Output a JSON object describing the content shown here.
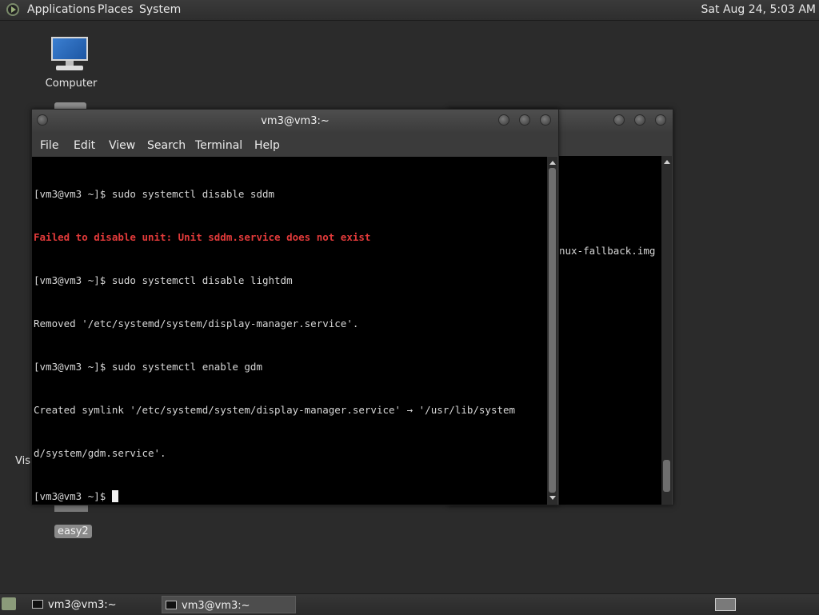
{
  "top_panel": {
    "menus": [
      "Applications",
      "Places",
      "System"
    ],
    "clock": "Sat Aug 24,  5:03 AM"
  },
  "desktop": {
    "icons": [
      {
        "label": "Computer"
      },
      {
        "label": "easy2"
      }
    ],
    "partial_label": "Visu"
  },
  "back_window": {
    "visible_text": "nux-fallback.img"
  },
  "terminal": {
    "title": "vm3@vm3:~",
    "menu": [
      "File",
      "Edit",
      "View",
      "Search",
      "Terminal",
      "Help"
    ],
    "lines": [
      {
        "text": "[vm3@vm3 ~]$ sudo systemctl disable sddm",
        "style": "normal"
      },
      {
        "text": "Failed to disable unit: Unit sddm.service does not exist",
        "style": "error"
      },
      {
        "text": "[vm3@vm3 ~]$ sudo systemctl disable lightdm",
        "style": "normal"
      },
      {
        "text": "Removed '/etc/systemd/system/display-manager.service'.",
        "style": "normal"
      },
      {
        "text": "[vm3@vm3 ~]$ sudo systemctl enable gdm",
        "style": "normal"
      },
      {
        "text": "Created symlink '/etc/systemd/system/display-manager.service' → '/usr/lib/system",
        "style": "normal"
      },
      {
        "text": "d/system/gdm.service'.",
        "style": "normal"
      },
      {
        "text": "[vm3@vm3 ~]$ ",
        "style": "prompt"
      }
    ]
  },
  "taskbar": {
    "tasks": [
      {
        "label": "vm3@vm3:~",
        "active": false
      },
      {
        "label": "vm3@vm3:~",
        "active": true
      }
    ]
  },
  "colors": {
    "desktop_bg": "#2b2b2b",
    "terminal_bg": "#000000",
    "error_text": "#e23a3a"
  }
}
